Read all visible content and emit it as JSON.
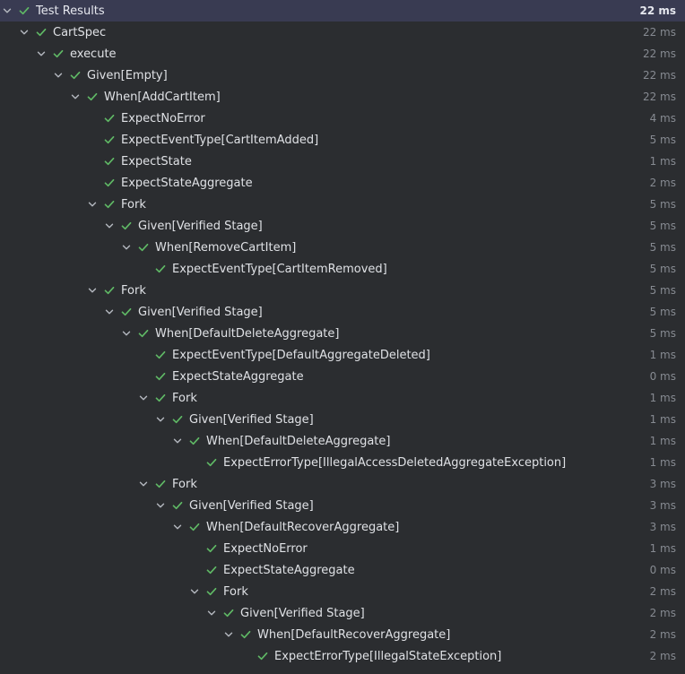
{
  "colors": {
    "background": "#2b2d30",
    "selected_row": "#393b52",
    "pass_check": "#5fb865",
    "chevron": "#b4b8bf",
    "duration_text": "#868a91"
  },
  "icons": {
    "expand": "chevron-down-icon",
    "status": "checkmark-icon"
  },
  "tree": [
    {
      "name": "Test Results",
      "time": "22 ms",
      "depth": 0,
      "expandable": true,
      "selected": true
    },
    {
      "name": "CartSpec",
      "time": "22 ms",
      "depth": 1,
      "expandable": true
    },
    {
      "name": "execute",
      "time": "22 ms",
      "depth": 2,
      "expandable": true
    },
    {
      "name": "Given[Empty]",
      "time": "22 ms",
      "depth": 3,
      "expandable": true
    },
    {
      "name": "When[AddCartItem]",
      "time": "22 ms",
      "depth": 4,
      "expandable": true
    },
    {
      "name": "ExpectNoError",
      "time": "4 ms",
      "depth": 5,
      "expandable": false
    },
    {
      "name": "ExpectEventType[CartItemAdded]",
      "time": "5 ms",
      "depth": 5,
      "expandable": false
    },
    {
      "name": "ExpectState",
      "time": "1 ms",
      "depth": 5,
      "expandable": false
    },
    {
      "name": "ExpectStateAggregate",
      "time": "2 ms",
      "depth": 5,
      "expandable": false
    },
    {
      "name": "Fork",
      "time": "5 ms",
      "depth": 5,
      "expandable": true
    },
    {
      "name": "Given[Verified Stage]",
      "time": "5 ms",
      "depth": 6,
      "expandable": true
    },
    {
      "name": "When[RemoveCartItem]",
      "time": "5 ms",
      "depth": 7,
      "expandable": true
    },
    {
      "name": "ExpectEventType[CartItemRemoved]",
      "time": "5 ms",
      "depth": 8,
      "expandable": false
    },
    {
      "name": "Fork",
      "time": "5 ms",
      "depth": 5,
      "expandable": true
    },
    {
      "name": "Given[Verified Stage]",
      "time": "5 ms",
      "depth": 6,
      "expandable": true
    },
    {
      "name": "When[DefaultDeleteAggregate]",
      "time": "5 ms",
      "depth": 7,
      "expandable": true
    },
    {
      "name": "ExpectEventType[DefaultAggregateDeleted]",
      "time": "1 ms",
      "depth": 8,
      "expandable": false
    },
    {
      "name": "ExpectStateAggregate",
      "time": "0 ms",
      "depth": 8,
      "expandable": false
    },
    {
      "name": "Fork",
      "time": "1 ms",
      "depth": 8,
      "expandable": true
    },
    {
      "name": "Given[Verified Stage]",
      "time": "1 ms",
      "depth": 9,
      "expandable": true
    },
    {
      "name": "When[DefaultDeleteAggregate]",
      "time": "1 ms",
      "depth": 10,
      "expandable": true
    },
    {
      "name": "ExpectErrorType[IllegalAccessDeletedAggregateException]",
      "time": "1 ms",
      "depth": 11,
      "expandable": false
    },
    {
      "name": "Fork",
      "time": "3 ms",
      "depth": 8,
      "expandable": true
    },
    {
      "name": "Given[Verified Stage]",
      "time": "3 ms",
      "depth": 9,
      "expandable": true
    },
    {
      "name": "When[DefaultRecoverAggregate]",
      "time": "3 ms",
      "depth": 10,
      "expandable": true
    },
    {
      "name": "ExpectNoError",
      "time": "1 ms",
      "depth": 11,
      "expandable": false
    },
    {
      "name": "ExpectStateAggregate",
      "time": "0 ms",
      "depth": 11,
      "expandable": false
    },
    {
      "name": "Fork",
      "time": "2 ms",
      "depth": 11,
      "expandable": true
    },
    {
      "name": "Given[Verified Stage]",
      "time": "2 ms",
      "depth": 12,
      "expandable": true
    },
    {
      "name": "When[DefaultRecoverAggregate]",
      "time": "2 ms",
      "depth": 13,
      "expandable": true
    },
    {
      "name": "ExpectErrorType[IllegalStateException]",
      "time": "2 ms",
      "depth": 14,
      "expandable": false
    }
  ]
}
